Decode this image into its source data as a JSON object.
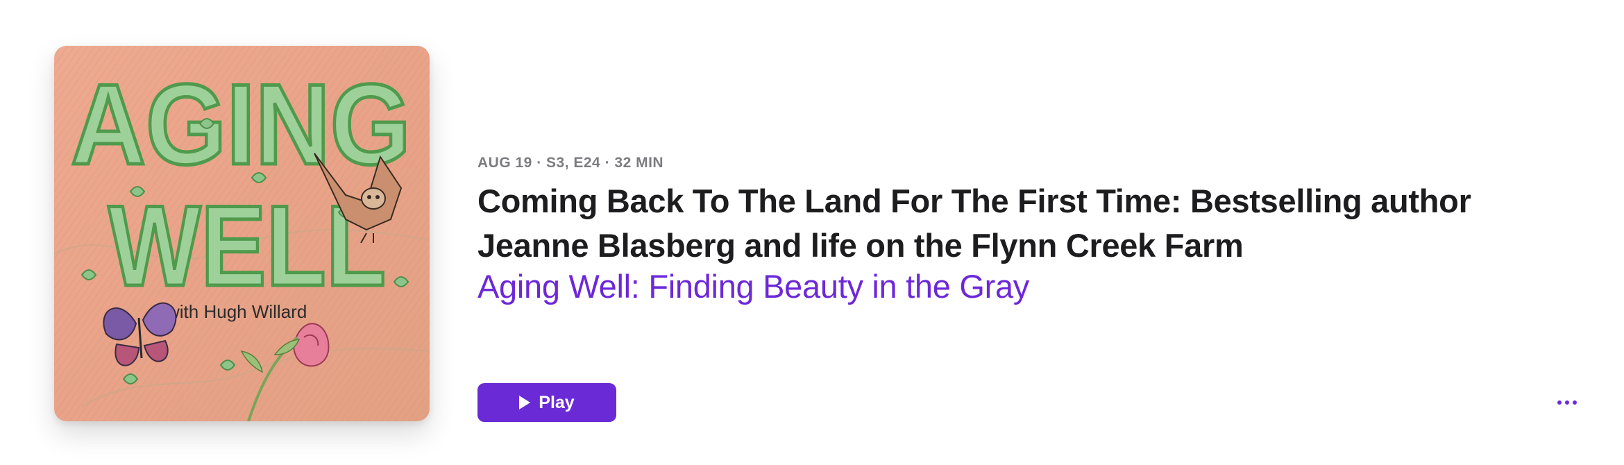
{
  "artwork": {
    "logo_line1": "AGING",
    "logo_line2": "WELL",
    "logo_byline": "with Hugh Willard"
  },
  "episode": {
    "meta": "AUG 19 · S3, E24 · 32 MIN",
    "title": "Coming Back To The Land For The First Time: Bestselling author Jeanne Blasberg and life on the Flynn Creek Farm",
    "show_name": "Aging Well: Finding Beauty in the Gray"
  },
  "actions": {
    "play_label": "Play",
    "play_icon": "play-icon",
    "more_icon": "ellipsis-icon"
  },
  "colors": {
    "accent": "#6a2bd6",
    "link": "#6d28d9",
    "title": "#1d1d1f",
    "meta": "#7c7c80",
    "artwork_bg": "#e9a58b",
    "artwork_letters": "#8fc98a"
  }
}
